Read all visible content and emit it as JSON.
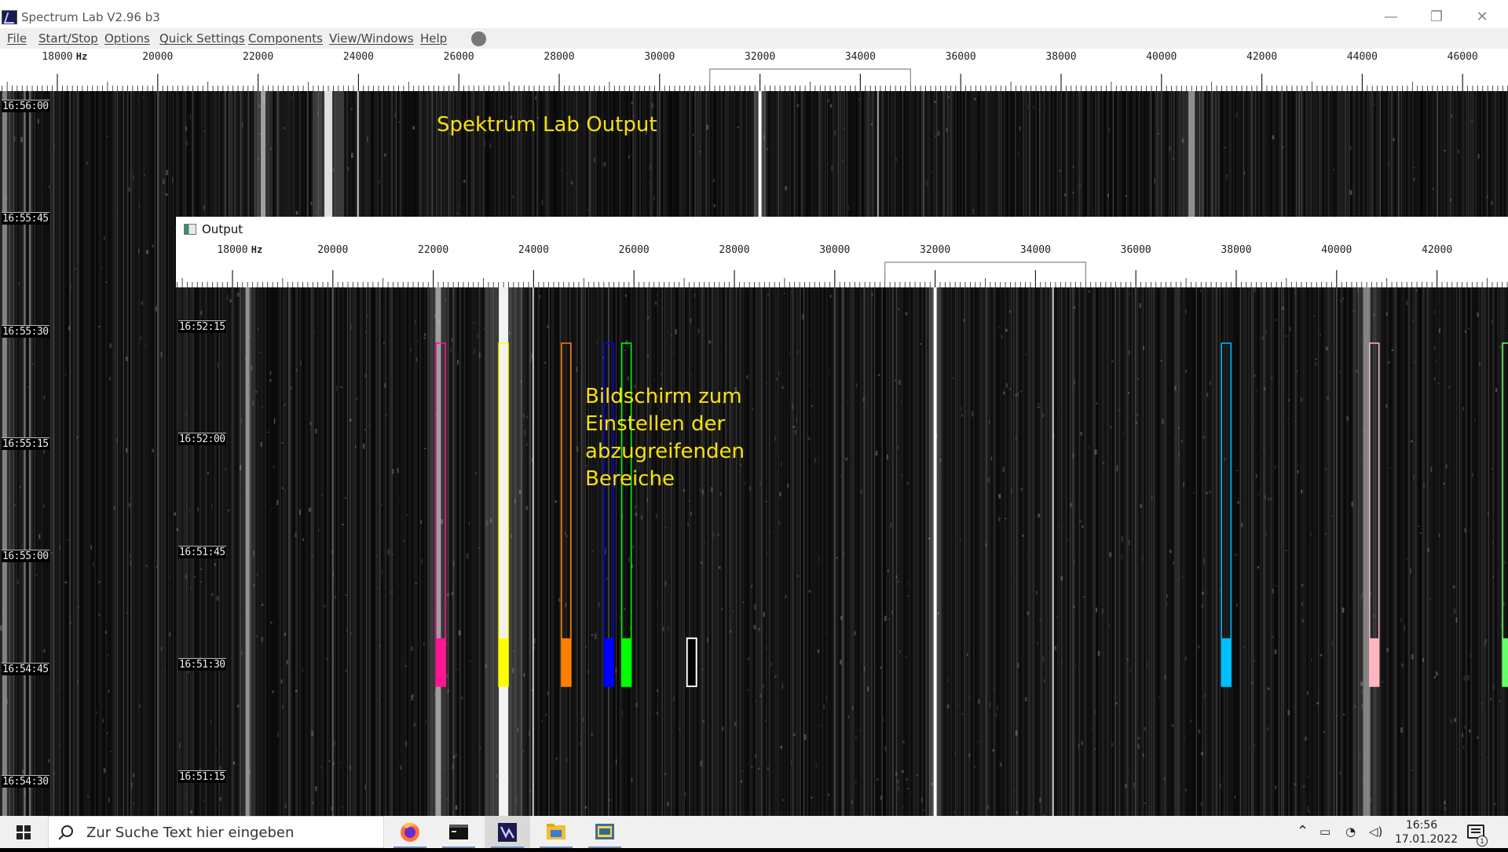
{
  "window": {
    "title": "Spectrum Lab V2.96 b3",
    "controls": [
      "—",
      "❐",
      "✕"
    ]
  },
  "menu": {
    "items": [
      "File",
      "Start/Stop",
      "Options",
      "Quick Settings",
      "Components",
      "View/Windows",
      "Help"
    ]
  },
  "main_scale": {
    "unit": "Hz",
    "labels": [
      "18000",
      "20000",
      "22000",
      "24000",
      "26000",
      "28000",
      "30000",
      "32000",
      "34000",
      "36000",
      "38000",
      "40000",
      "42000",
      "44000",
      "46000"
    ]
  },
  "main_waterfall": {
    "annotation": "Spektrum Lab Output",
    "time_labels": [
      "16:56:00",
      "16:55:45",
      "16:55:30",
      "16:55:15",
      "16:55:00",
      "16:54:45",
      "16:54:30"
    ]
  },
  "output_window": {
    "title": "Output",
    "scale_unit": "Hz",
    "scale_labels": [
      "18000",
      "20000",
      "22000",
      "24000",
      "26000",
      "28000",
      "30000",
      "32000",
      "34000",
      "36000",
      "38000",
      "40000",
      "42000"
    ],
    "time_labels": [
      "16:52:15",
      "16:52:00",
      "16:51:45",
      "16:51:30",
      "16:51:15"
    ],
    "annotation_lines": [
      "Bildschirm zum",
      "Einstellen der",
      "abzugreifenden",
      "Bereiche"
    ],
    "band_markers": [
      {
        "freq_hz": 22150,
        "color": "#ff1493",
        "level": 0.1
      },
      {
        "freq_hz": 23400,
        "color": "#ffff00",
        "level": 0.1
      },
      {
        "freq_hz": 24650,
        "color": "#ff8000",
        "level": 0.1
      },
      {
        "freq_hz": 25500,
        "color": "#0000ff",
        "level": 0.1
      },
      {
        "freq_hz": 25850,
        "color": "#00ff00",
        "level": 0.1
      },
      {
        "freq_hz": 27150,
        "color": "#000000",
        "level": 0.1
      },
      {
        "freq_hz": 37800,
        "color": "#00bfff",
        "level": 0.1
      },
      {
        "freq_hz": 40750,
        "color": "#ffb6c1",
        "level": 0.1
      },
      {
        "freq_hz": 43400,
        "color": "#66ff66",
        "level": 0.1
      }
    ]
  },
  "taskbar": {
    "search_placeholder": "Zur Suche Text hier eingeben",
    "apps": [
      "firefox",
      "terminal",
      "spectrum-lab",
      "file-explorer",
      "python"
    ],
    "clock_time": "16:56",
    "clock_date": "17.01.2022",
    "notification_count": "1"
  }
}
